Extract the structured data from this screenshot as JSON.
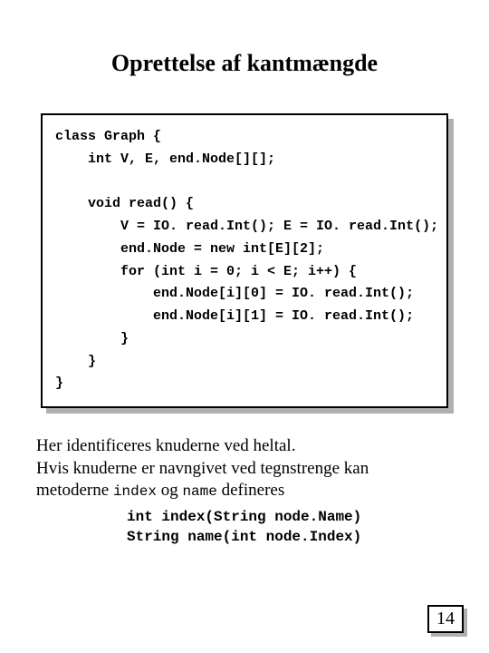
{
  "title": "Oprettelse af kantmængde",
  "code": "class Graph {\n    int V, E, end.Node[][];\n\n    void read() {\n        V = IO. read.Int(); E = IO. read.Int();\n        end.Node = new int[E][2];\n        for (int i = 0; i < E; i++) {\n            end.Node[i][0] = IO. read.Int();\n            end.Node[i][1] = IO. read.Int();\n        }\n    }\n}",
  "para": {
    "line1": "Her identificeres knuderne ved heltal.",
    "line2a": "Hvis knuderne er navngivet ved tegnstrenge kan",
    "line3a": "metoderne ",
    "code1": "index",
    "mid": " og ",
    "code2": "name",
    "line3b": " defineres"
  },
  "sigs": "int index(String node.Name)\nString name(int node.Index)",
  "page_number": "14"
}
